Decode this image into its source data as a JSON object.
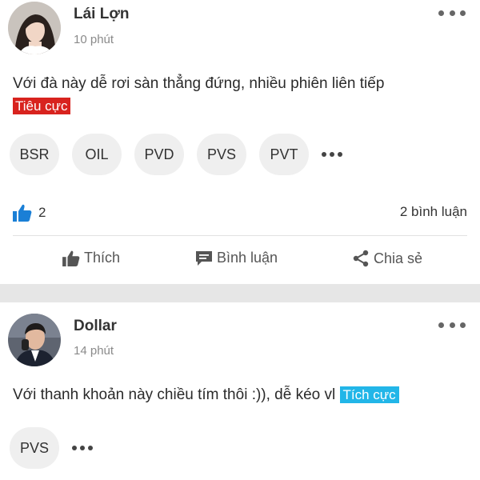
{
  "posts": [
    {
      "author": "Lái Lợn",
      "time": "10 phút",
      "text": "Với đà này dễ rơi sàn thẳng đứng, nhiều phiên liên tiếp",
      "sentiment": "Tiêu cực",
      "sentiment_color": "#d8231e",
      "tickers": [
        "BSR",
        "OIL",
        "PVD",
        "PVS",
        "PVT"
      ],
      "like_count": "2",
      "comment_count": "2 bình luận",
      "actions": {
        "like": "Thích",
        "comment": "Bình luận",
        "share": "Chia sẻ"
      }
    },
    {
      "author": "Dollar",
      "time": "14 phút",
      "text": "Với thanh khoản này chiều tím thôi :)), dễ kéo vl",
      "sentiment": "Tích cực",
      "sentiment_color": "#22b6e8",
      "tickers": [
        "PVS"
      ]
    }
  ],
  "icons": [
    "more-icon",
    "thumbs-up-icon",
    "comment-icon",
    "share-icon"
  ],
  "colors": {
    "like_blue": "#1a7fd6",
    "separator": "#e6e6e6",
    "chip_bg": "#efefef"
  }
}
